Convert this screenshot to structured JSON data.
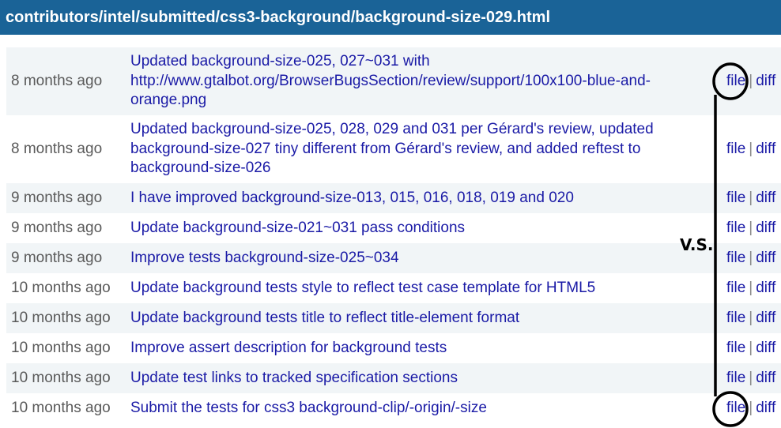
{
  "header": {
    "path": "contributors/intel/submitted/css3-background/background-size-029.html"
  },
  "log": [
    {
      "time": "8 months ago",
      "message": "Updated background-size-025, 027~031 with http://www.gtalbot.org/BrowserBugsSection/review/support/100x100-blue-and-orange.png",
      "file": "file",
      "diff": "diff"
    },
    {
      "time": "8 months ago",
      "message": "Updated background-size-025, 028, 029 and 031 per Gérard's review, updated background-size-027 tiny different from Gérard's review, and added reftest to background-size-026",
      "file": "file",
      "diff": "diff"
    },
    {
      "time": "9 months ago",
      "message": "I have improved background-size-013, 015, 016, 018, 019 and 020",
      "file": "file",
      "diff": "diff"
    },
    {
      "time": "9 months ago",
      "message": "Update background-size-021~031 pass conditions",
      "file": "file",
      "diff": "diff"
    },
    {
      "time": "9 months ago",
      "message": "Improve tests background-size-025~034",
      "file": "file",
      "diff": "diff"
    },
    {
      "time": "10 months ago",
      "message": "Update background tests style to reflect test case template for HTML5",
      "file": "file",
      "diff": "diff"
    },
    {
      "time": "10 months ago",
      "message": "Update background tests title to reflect title-element format",
      "file": "file",
      "diff": "diff"
    },
    {
      "time": "10 months ago",
      "message": "Improve assert description for background tests",
      "file": "file",
      "diff": "diff"
    },
    {
      "time": "10 months ago",
      "message": "Update test links to tracked specification sections",
      "file": "file",
      "diff": "diff"
    },
    {
      "time": "10 months ago",
      "message": "Submit the tests for css3 background-clip/-origin/-size",
      "file": "file",
      "diff": "diff"
    }
  ],
  "separator": "|",
  "annotation": {
    "label": "V.S.",
    "color": "#000000"
  },
  "colors": {
    "header_bg": "#1a6397",
    "link": "#1a1aa6",
    "time_text": "#5a5a5a",
    "row_stripe": "#f1f5f7"
  }
}
